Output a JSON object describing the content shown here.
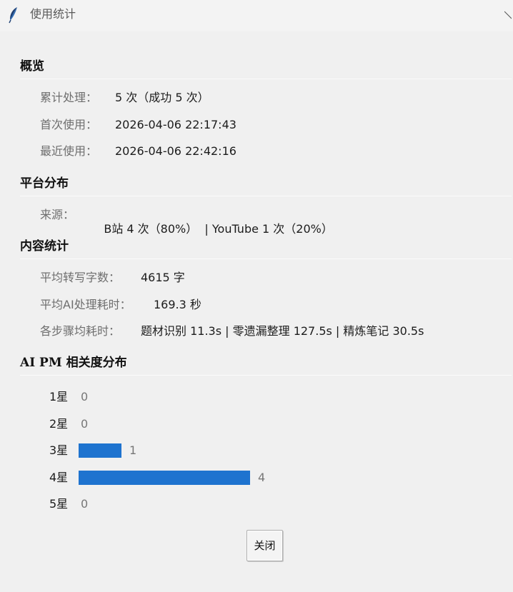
{
  "window": {
    "title": "使用统计",
    "bar_color": "#1e73cf"
  },
  "overview": {
    "heading": "概览",
    "rows": [
      {
        "label": "累计处理：",
        "value": "5 次（成功 5 次）"
      },
      {
        "label": "首次使用：",
        "value": "2026-04-06 22:17:43"
      },
      {
        "label": "最近使用：",
        "value": "2026-04-06 22:42:16"
      }
    ]
  },
  "platform": {
    "heading": "平台分布",
    "label": "来源：",
    "value": "B站 4 次（80%）  | YouTube 1 次（20%）"
  },
  "content": {
    "heading": "内容统计",
    "rows": [
      {
        "label": "平均转写字数：",
        "value": "4615 字"
      },
      {
        "label": "平均AI处理耗时：",
        "value": "169.3 秒"
      },
      {
        "label": "各步骤均耗时：",
        "value": "题材识别 11.3s | 零遗漏整理 127.5s | 精炼笔记 30.5s"
      }
    ]
  },
  "chart_data": {
    "type": "bar",
    "title": "AI PM 相关度分布",
    "orientation": "horizontal",
    "categories": [
      "1星",
      "2星",
      "3星",
      "4星",
      "5星"
    ],
    "values": [
      0,
      0,
      1,
      4,
      0
    ],
    "labels": [
      "0",
      "0",
      "1",
      "4",
      "0"
    ],
    "color": "#1e73cf"
  },
  "footer": {
    "close_label": "关闭"
  }
}
